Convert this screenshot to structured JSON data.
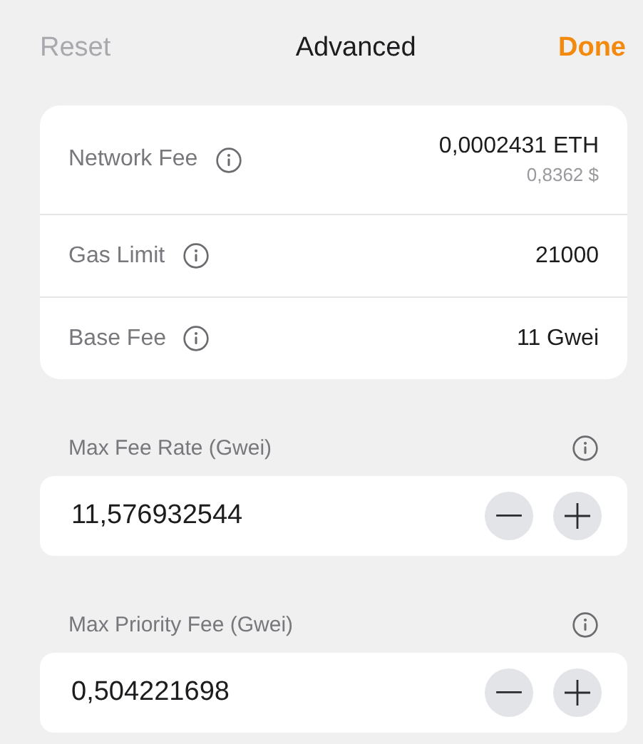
{
  "header": {
    "reset": {
      "label": "Reset",
      "disabled": true
    },
    "title": "Advanced",
    "done": {
      "label": "Done",
      "disabled": false
    }
  },
  "summary": [
    {
      "label": "Network Fee",
      "value": "0,0002431 ETH",
      "subvalue": "0,8362 $"
    },
    {
      "label": "Gas Limit",
      "value": "21000"
    },
    {
      "label": "Base Fee",
      "value": "11 Gwei"
    }
  ],
  "fields": [
    {
      "label": "Max Fee Rate (Gwei)",
      "value": "11,576932544"
    },
    {
      "label": "Max Priority Fee (Gwei)",
      "value": "0,504221698"
    }
  ]
}
